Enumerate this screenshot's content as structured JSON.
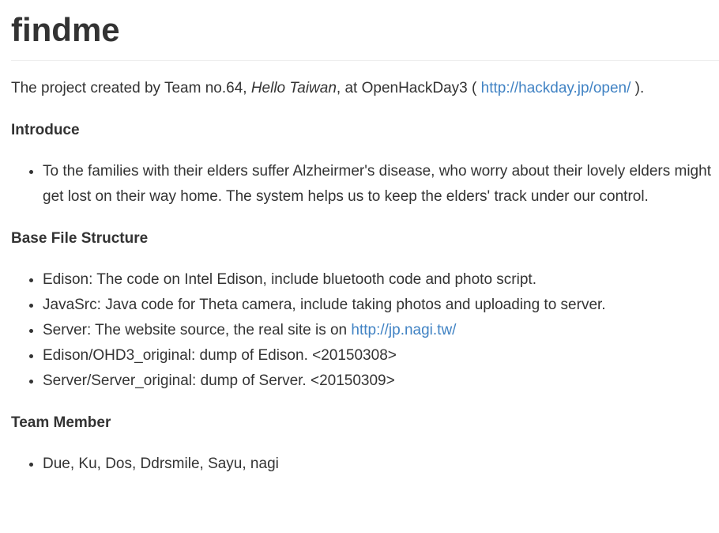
{
  "title": "findme",
  "intro": {
    "prefix": "The project created by Team no.64, ",
    "team_name": "Hello Taiwan",
    "middle": ", at OpenHackDay3 ( ",
    "link_text": "http://hackday.jp/open/",
    "suffix": " )."
  },
  "sections": {
    "introduce": {
      "heading": "Introduce",
      "items": [
        "To the families with their elders suffer Alzheirmer's disease, who worry about their lovely elders might get lost on their way home. The system helps us to keep the elders' track under our control."
      ]
    },
    "structure": {
      "heading": "Base File Structure",
      "item1": "Edison: The code on Intel Edison, include bluetooth code and photo script.",
      "item2": "JavaSrc: Java code for Theta camera, include taking photos and uploading to server.",
      "item3_prefix": "Server: The website source, the real site is on ",
      "item3_link": "http://jp.nagi.tw/",
      "item4": "Edison/OHD3_original: dump of Edison. <20150308>",
      "item5": "Server/Server_original: dump of Server. <20150309>"
    },
    "team": {
      "heading": "Team Member",
      "items": [
        "Due, Ku, Dos, Ddrsmile, Sayu, nagi"
      ]
    }
  },
  "colors": {
    "text": "#333333",
    "link": "#4183c4",
    "rule": "#eeeeee"
  }
}
